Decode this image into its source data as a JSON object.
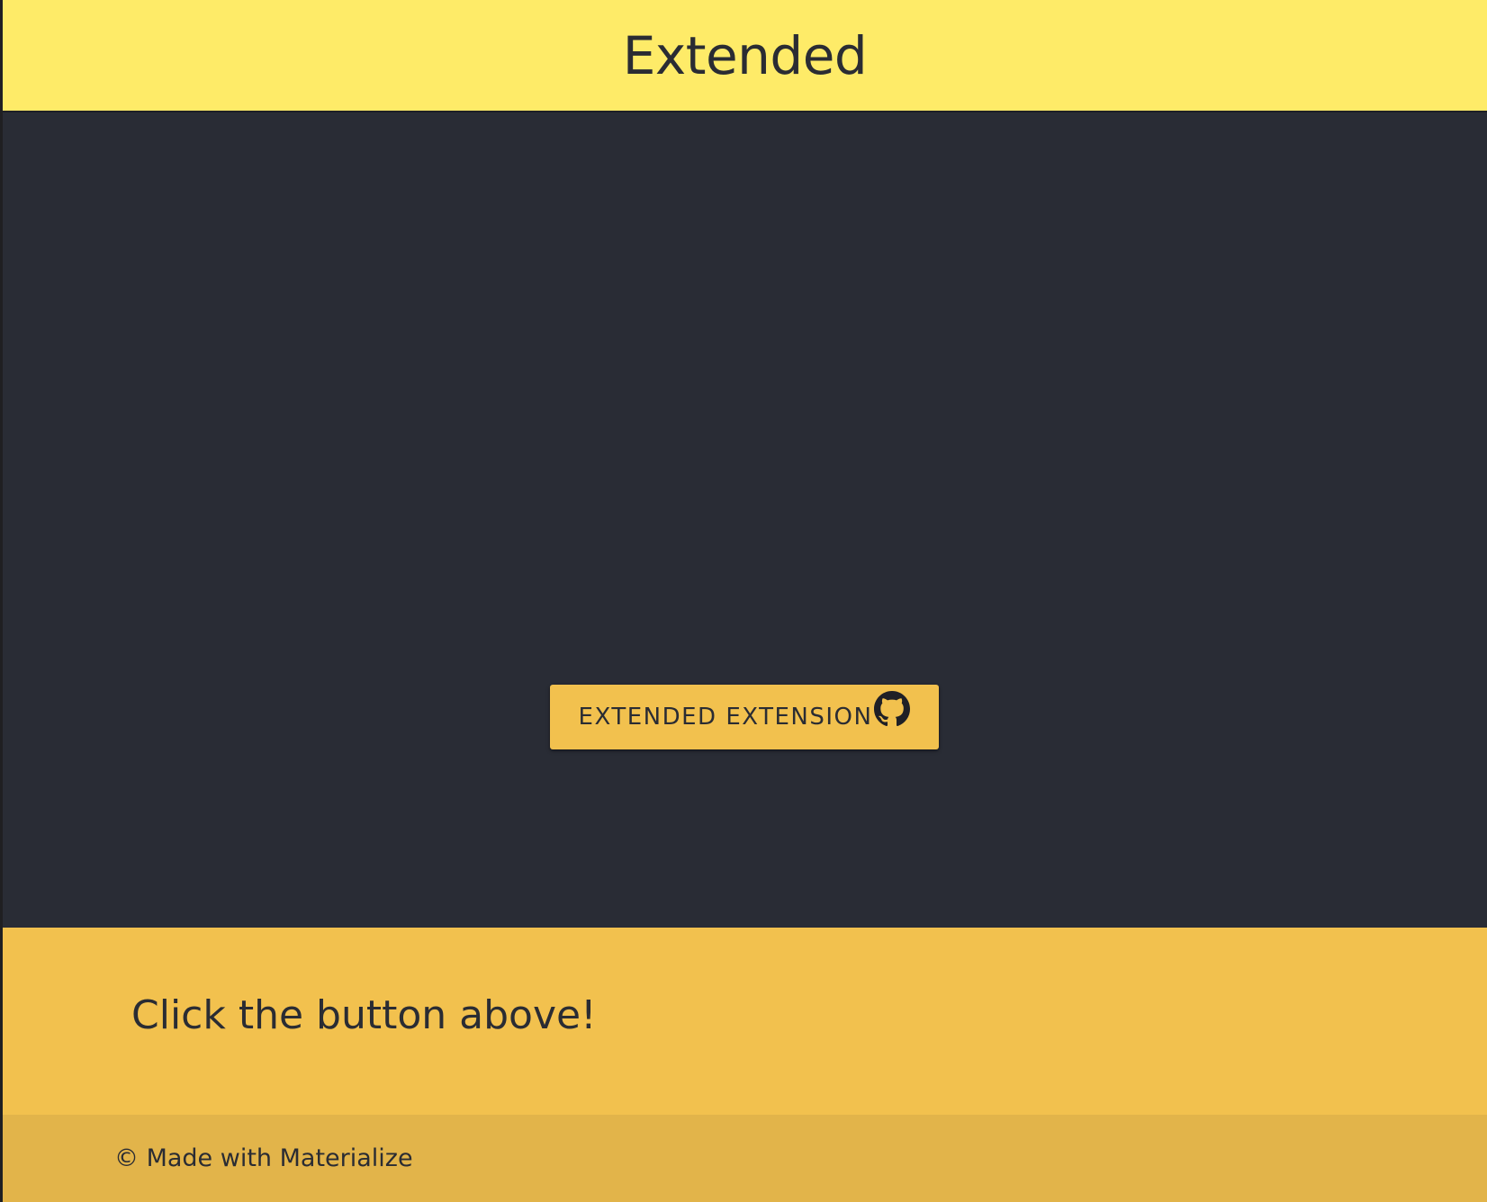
{
  "header": {
    "title": "Extended"
  },
  "main": {
    "button_label": "EXTENDED EXTENSION",
    "button_icon": "github-icon"
  },
  "info": {
    "message": "Click the button above!"
  },
  "footer": {
    "text": "© Made with Materialize"
  },
  "colors": {
    "header_bg": "#feeb68",
    "main_bg": "#292c35",
    "accent": "#f2c14e",
    "footer_bg": "#e2b44a",
    "text": "#2a2c33"
  }
}
